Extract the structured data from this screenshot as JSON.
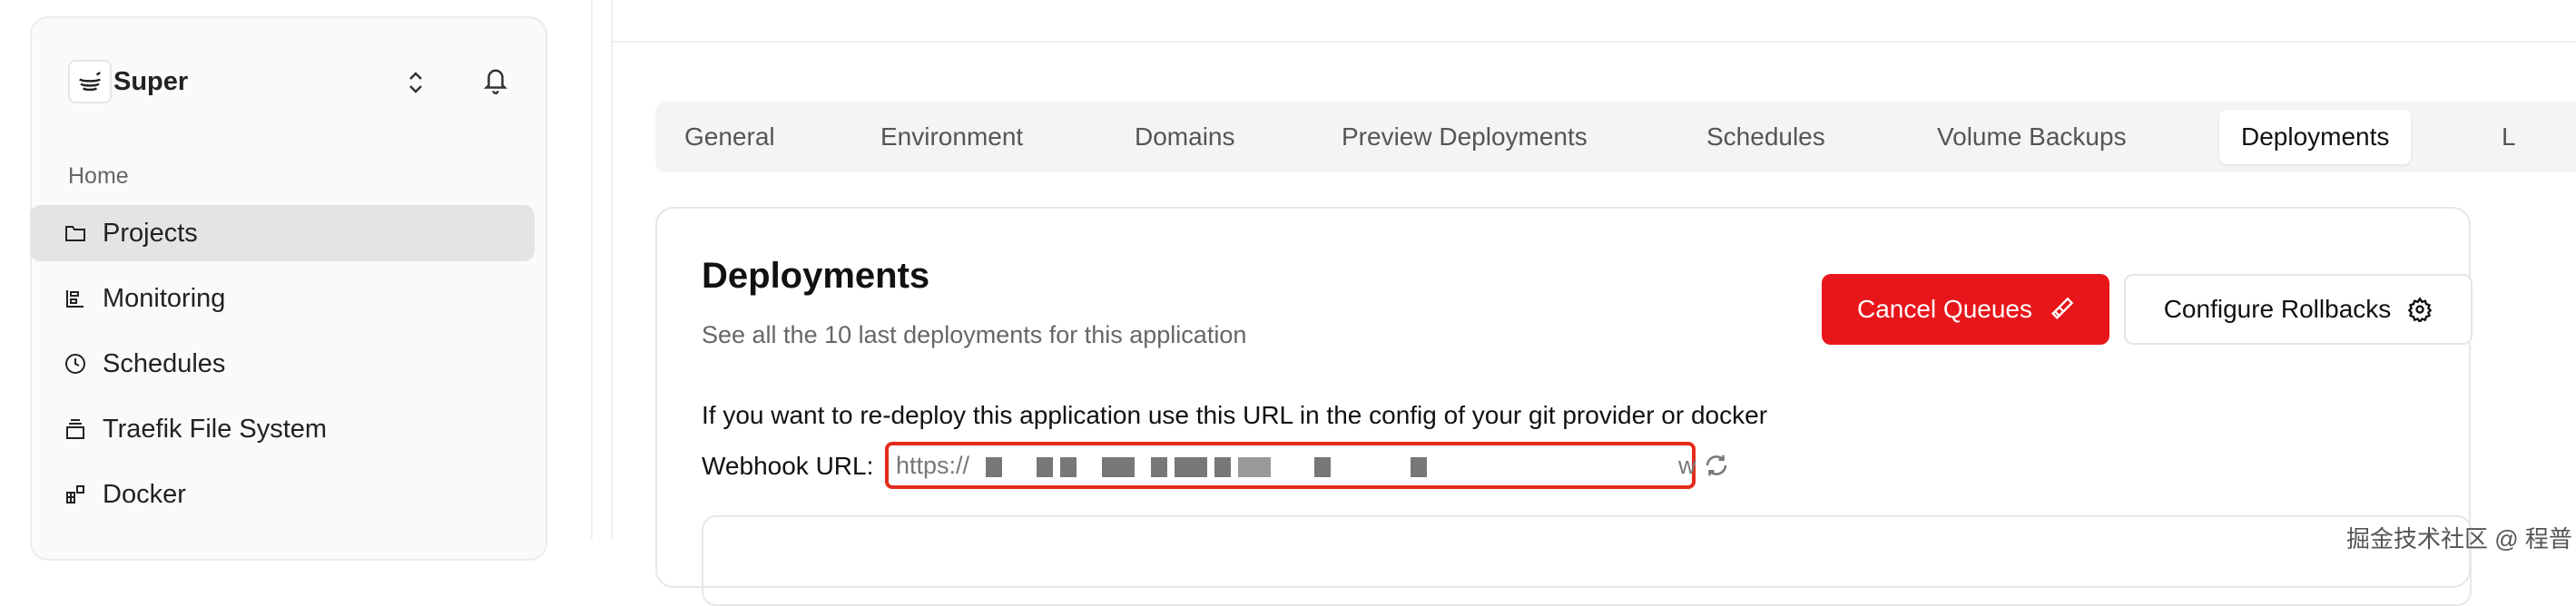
{
  "sidebar": {
    "team": "Super",
    "section": "Home",
    "items": [
      {
        "label": "Projects",
        "icon": "folder-icon",
        "active": true
      },
      {
        "label": "Monitoring",
        "icon": "monitoring-icon"
      },
      {
        "label": "Schedules",
        "icon": "clock-icon"
      },
      {
        "label": "Traefik File System",
        "icon": "traefik-icon"
      },
      {
        "label": "Docker",
        "icon": "docker-icon"
      }
    ]
  },
  "tabs": [
    "General",
    "Environment",
    "Domains",
    "Preview Deployments",
    "Schedules",
    "Volume Backups",
    "Deployments",
    "L"
  ],
  "card": {
    "title": "Deployments",
    "subtitle": "See all the 10 last deployments for this application",
    "cancel": "Cancel Queues",
    "configure": "Configure Rollbacks",
    "info": "If you want to re-deploy this application use this URL in the config of your git provider or docker",
    "webhook_label": "Webhook URL:",
    "webhook_prefix": "https://",
    "webhook_suffix": "w"
  },
  "watermark": "掘金技术社区 @ 程普",
  "colors": {
    "danger": "#e8161b",
    "highlight": "#e42b1c"
  }
}
